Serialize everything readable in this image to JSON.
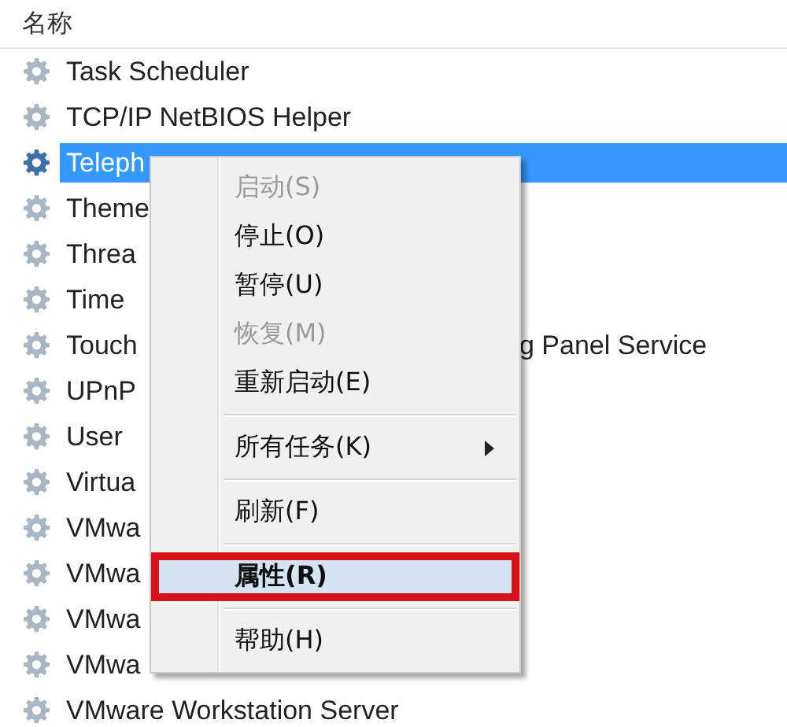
{
  "header": {
    "column_1": "名称"
  },
  "rows": [
    {
      "name": "Task Scheduler",
      "selected": false
    },
    {
      "name": "TCP/IP NetBIOS Helper",
      "selected": false
    },
    {
      "name": "Teleph",
      "selected": true
    },
    {
      "name": "Theme",
      "selected": false
    },
    {
      "name": "Threa",
      "selected": false
    },
    {
      "name": "Time",
      "selected": false
    },
    {
      "name": "Touch",
      "tail": "g Panel Service",
      "selected": false
    },
    {
      "name": "UPnP",
      "selected": false
    },
    {
      "name": "User",
      "selected": false
    },
    {
      "name": "Virtua",
      "selected": false
    },
    {
      "name": "VMwa",
      "selected": false
    },
    {
      "name": "VMwa",
      "selected": false
    },
    {
      "name": "VMwa",
      "selected": false
    },
    {
      "name": "VMwa",
      "selected": false
    },
    {
      "name": "VMware Workstation Server",
      "selected": false
    }
  ],
  "context_menu": [
    {
      "kind": "item",
      "label": "启动(S)",
      "disabled": true
    },
    {
      "kind": "item",
      "label": "停止(O)",
      "disabled": false
    },
    {
      "kind": "item",
      "label": "暂停(U)",
      "disabled": false
    },
    {
      "kind": "item",
      "label": "恢复(M)",
      "disabled": true
    },
    {
      "kind": "item",
      "label": "重新启动(E)",
      "disabled": false
    },
    {
      "kind": "separator"
    },
    {
      "kind": "item",
      "label": "所有任务(K)",
      "disabled": false,
      "submenu": true
    },
    {
      "kind": "separator"
    },
    {
      "kind": "item",
      "label": "刷新(F)",
      "disabled": false
    },
    {
      "kind": "separator"
    },
    {
      "kind": "item",
      "label": "属性(R)",
      "disabled": false,
      "bold": true,
      "highlighted": true
    },
    {
      "kind": "separator"
    },
    {
      "kind": "item",
      "label": "帮助(H)",
      "disabled": false
    }
  ]
}
